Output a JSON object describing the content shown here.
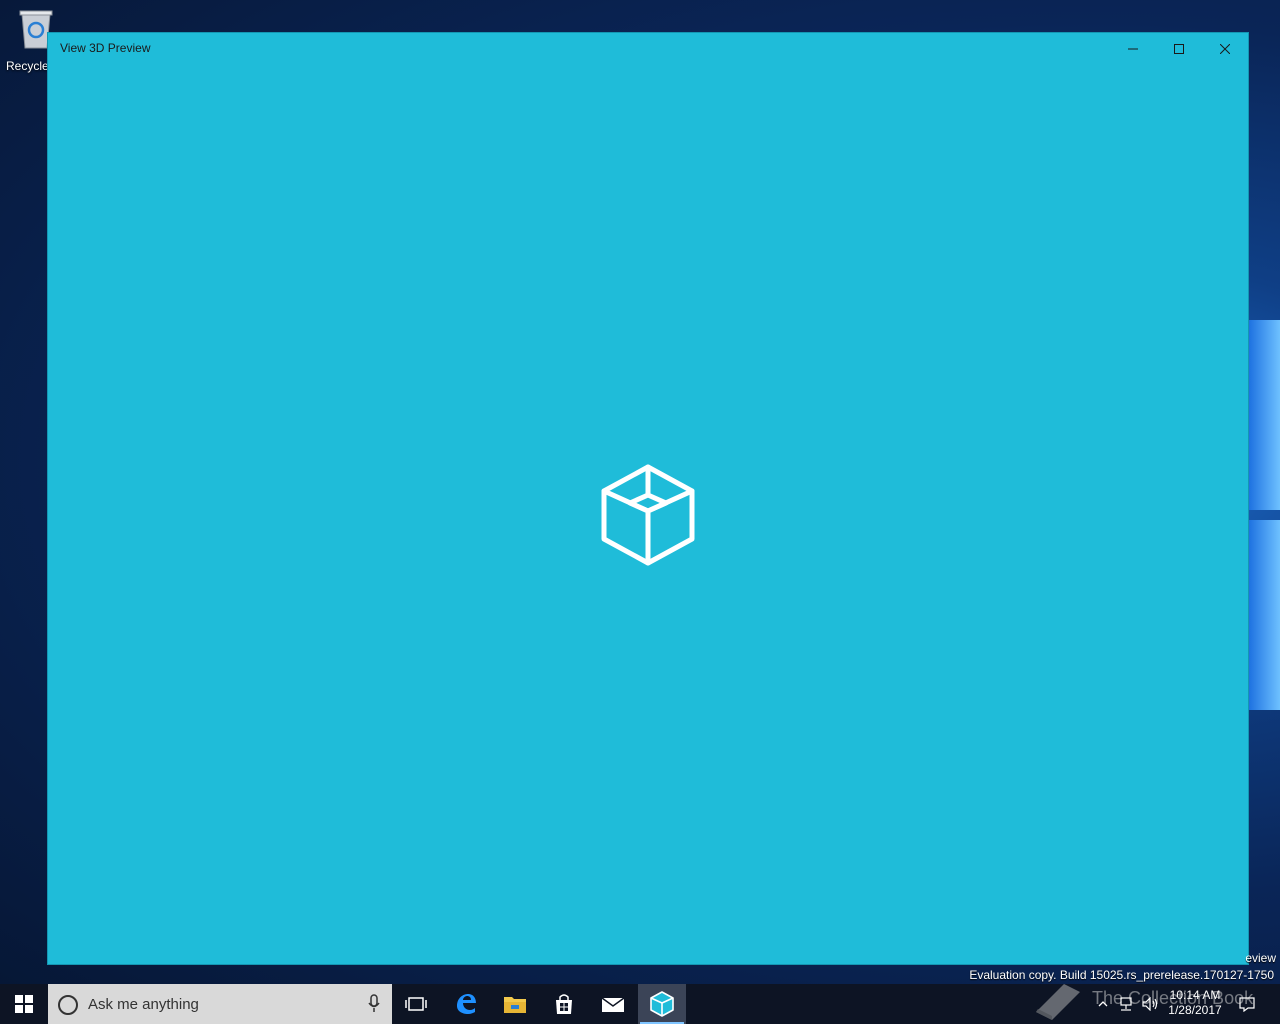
{
  "desktop": {
    "recycle_bin_label": "Recycle"
  },
  "window": {
    "title": "View 3D Preview",
    "accent_color": "#1fbcd9"
  },
  "system": {
    "eval_text": "Evaluation copy. Build 15025.rs_prerelease.170127-1750",
    "eval_partial": "eview"
  },
  "taskbar": {
    "search_placeholder": "Ask me anything",
    "time": "10:14 AM",
    "date": "1/28/2017"
  },
  "watermark": {
    "text": "The Collection Book"
  }
}
